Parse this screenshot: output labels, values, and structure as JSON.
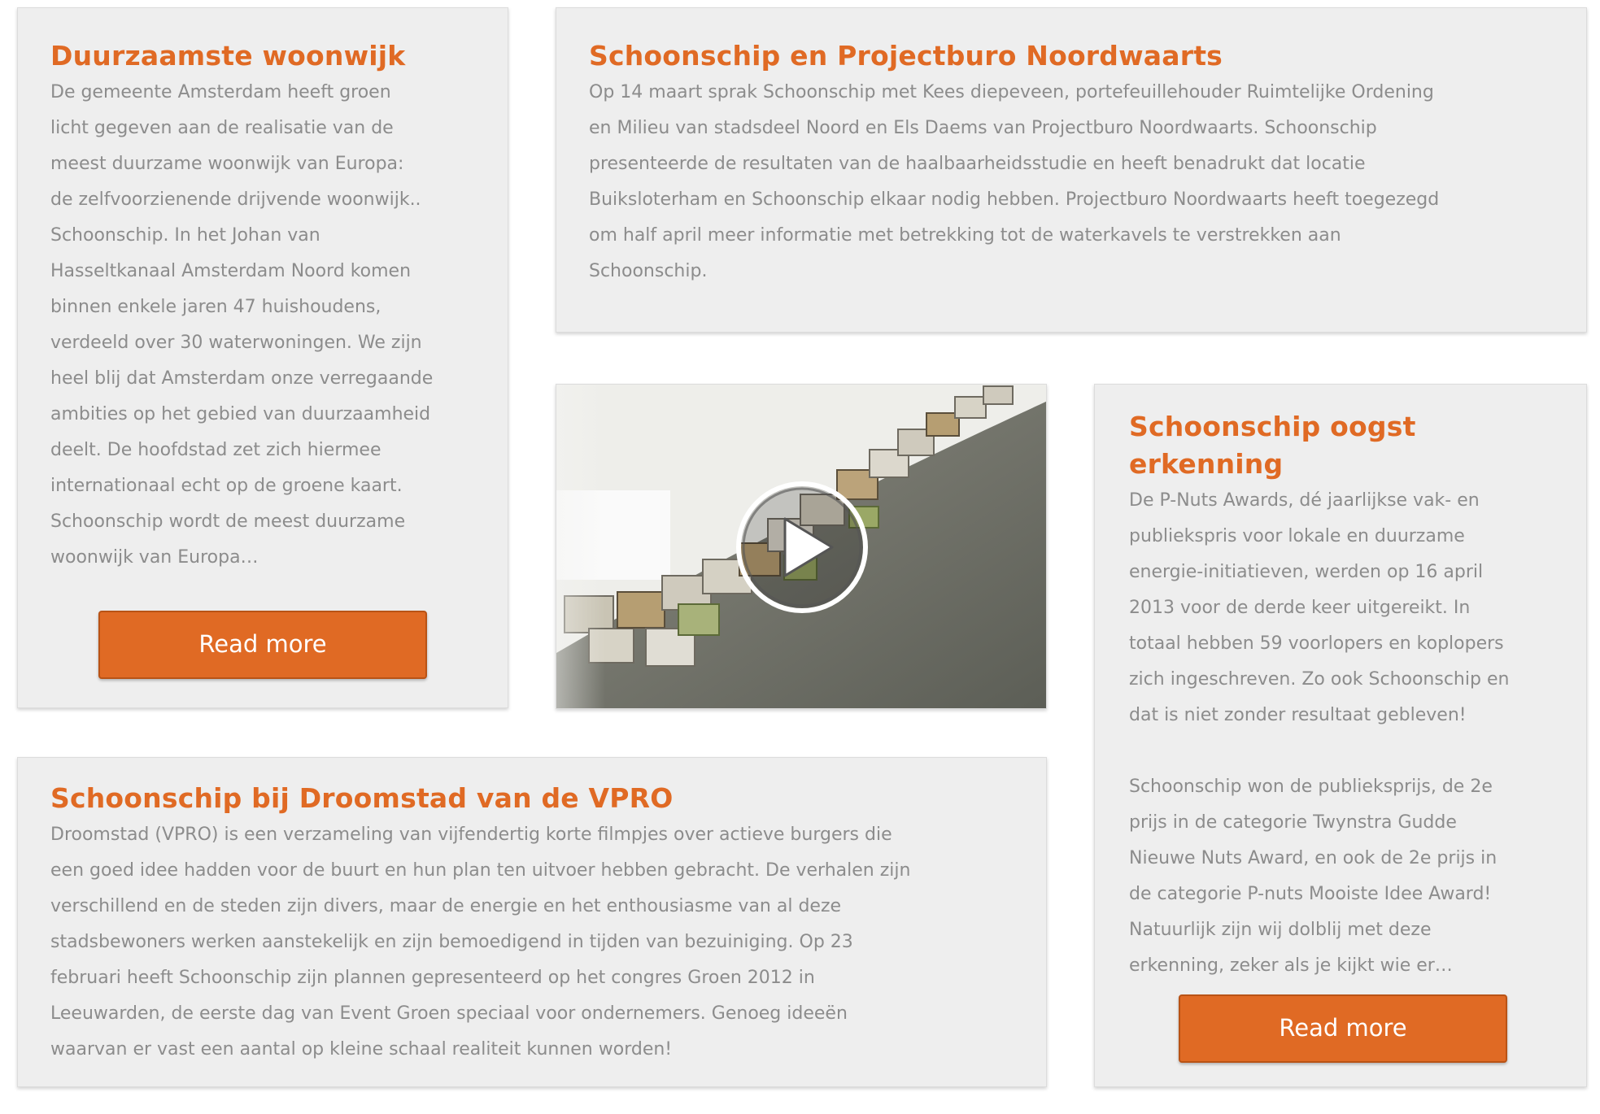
{
  "colors": {
    "accent": "#e06a24",
    "card_background": "#eeeeee",
    "body_text": "#8c8c8c"
  },
  "cards": {
    "woonwijk": {
      "title": "Duurzaamste woonwijk",
      "body": "De gemeente Amsterdam heeft groen\nlicht gegeven aan de realisatie van de\nmeest duurzame woonwijk van Europa:\nde zelfvoorzienende drijvende woonwijk..\nSchoonschip. In het Johan van\nHasseltkanaal Amsterdam Noord komen\nbinnen enkele jaren 47 huishoudens,\nverdeeld over 30 waterwoningen. We zijn\nheel blij dat Amsterdam onze verregaande\nambities op het gebied van duurzaamheid\ndeelt. De hoofdstad zet zich hiermee\ninternationaal echt op de groene kaart.\nSchoonschip wordt de meest duurzame\nwoonwijk van Europa…",
      "button": "Read more"
    },
    "projectburo": {
      "title": "Schoonschip en Projectburo Noordwaarts",
      "body": "Op 14 maart sprak Schoonschip met Kees diepeveen, portefeuillehouder Ruimtelijke Ordening\nen Milieu van stadsdeel Noord en Els Daems van Projectburo Noordwaarts. Schoonschip\npresenteerde de resultaten van de haalbaarheidsstudie en heeft benadrukt dat locatie\nBuiksloterham en Schoonschip elkaar nodig hebben. Projectburo Noordwaarts heeft toegezegd\nom half april meer informatie met betrekking tot de waterkavels te verstrekken aan\nSchoonschip."
    },
    "video": {
      "thumbnail_icon": "floating-houses-model-image",
      "play_icon": "play-icon"
    },
    "erkenning": {
      "title": "Schoonschip oogst erkenning",
      "body": "De P-Nuts Awards, dé jaarlijkse vak- en\npubliekspris voor lokale en duurzame\nenergie-initiatieven, werden op 16 april\n2013 voor de derde keer uitgereikt. In\ntotaal hebben 59 voorlopers en koplopers\nzich ingeschreven. Zo ook Schoonschip en\ndat is niet zonder resultaat gebleven!\n\nSchoonschip won de publieksprijs, de 2e\nprijs in de categorie Twynstra Gudde\nNieuwe Nuts Award, en ook de 2e prijs in\nde categorie P-nuts Mooiste Idee Award!\nNatuurlijk zijn wij dolblij met deze\nerkenning, zeker als je kijkt wie er…",
      "button": "Read more"
    },
    "droomstad": {
      "title": "Schoonschip bij Droomstad van de VPRO",
      "body": "Droomstad (VPRO) is een verzameling van vijfendertig korte filmpjes over actieve burgers die\neen goed idee hadden voor de buurt en hun plan ten uitvoer hebben gebracht. De verhalen zijn\nverschillend en de steden zijn divers, maar de energie en het enthousiasme van al deze\nstadsbewoners werken aanstekelijk en zijn bemoedigend in tijden van bezuiniging. Op 23\nfebruari heeft Schoonschip zijn plannen gepresenteerd op het congres Groen 2012 in\nLeeuwarden, de eerste dag van Event Groen speciaal voor ondernemers. Genoeg ideeën\nwaarvan er vast een aantal op kleine schaal realiteit kunnen worden!"
    }
  }
}
